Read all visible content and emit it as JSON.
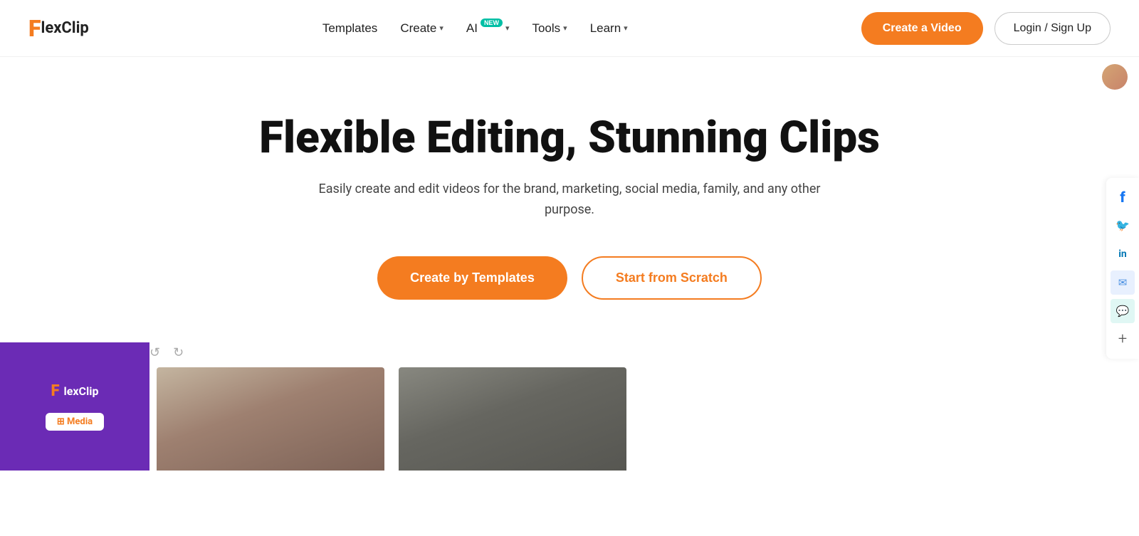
{
  "brand": {
    "logo_f": "F",
    "logo_rest": "lexClip"
  },
  "nav": {
    "links": [
      {
        "label": "Templates",
        "has_chevron": false
      },
      {
        "label": "Create",
        "has_chevron": true
      },
      {
        "label": "AI",
        "has_chevron": true,
        "badge": "NEW"
      },
      {
        "label": "Tools",
        "has_chevron": true
      },
      {
        "label": "Learn",
        "has_chevron": true
      }
    ],
    "cta_label": "Create a Video",
    "login_label": "Login / Sign Up"
  },
  "hero": {
    "title": "Flexible Editing, Stunning Clips",
    "subtitle": "Easily create and edit videos for the brand, marketing, social media, family, and any other purpose.",
    "btn_templates": "Create by Templates",
    "btn_scratch": "Start from Scratch"
  },
  "social": {
    "items": [
      {
        "name": "facebook-icon",
        "symbol": "f",
        "class": "social-fb"
      },
      {
        "name": "twitter-icon",
        "symbol": "🐦",
        "class": "social-tw"
      },
      {
        "name": "linkedin-icon",
        "symbol": "in",
        "class": "social-li"
      },
      {
        "name": "email-icon",
        "symbol": "✉",
        "class": "social-mail"
      },
      {
        "name": "chat-icon",
        "symbol": "💬",
        "class": "social-chat"
      },
      {
        "name": "more-icon",
        "symbol": "+",
        "class": "social-plus"
      }
    ]
  },
  "preview": {
    "logo_f": "F",
    "logo_text": "lexClip",
    "toolbar": {
      "undo_label": "↺",
      "redo_label": "↻",
      "media_label": "Media"
    }
  }
}
